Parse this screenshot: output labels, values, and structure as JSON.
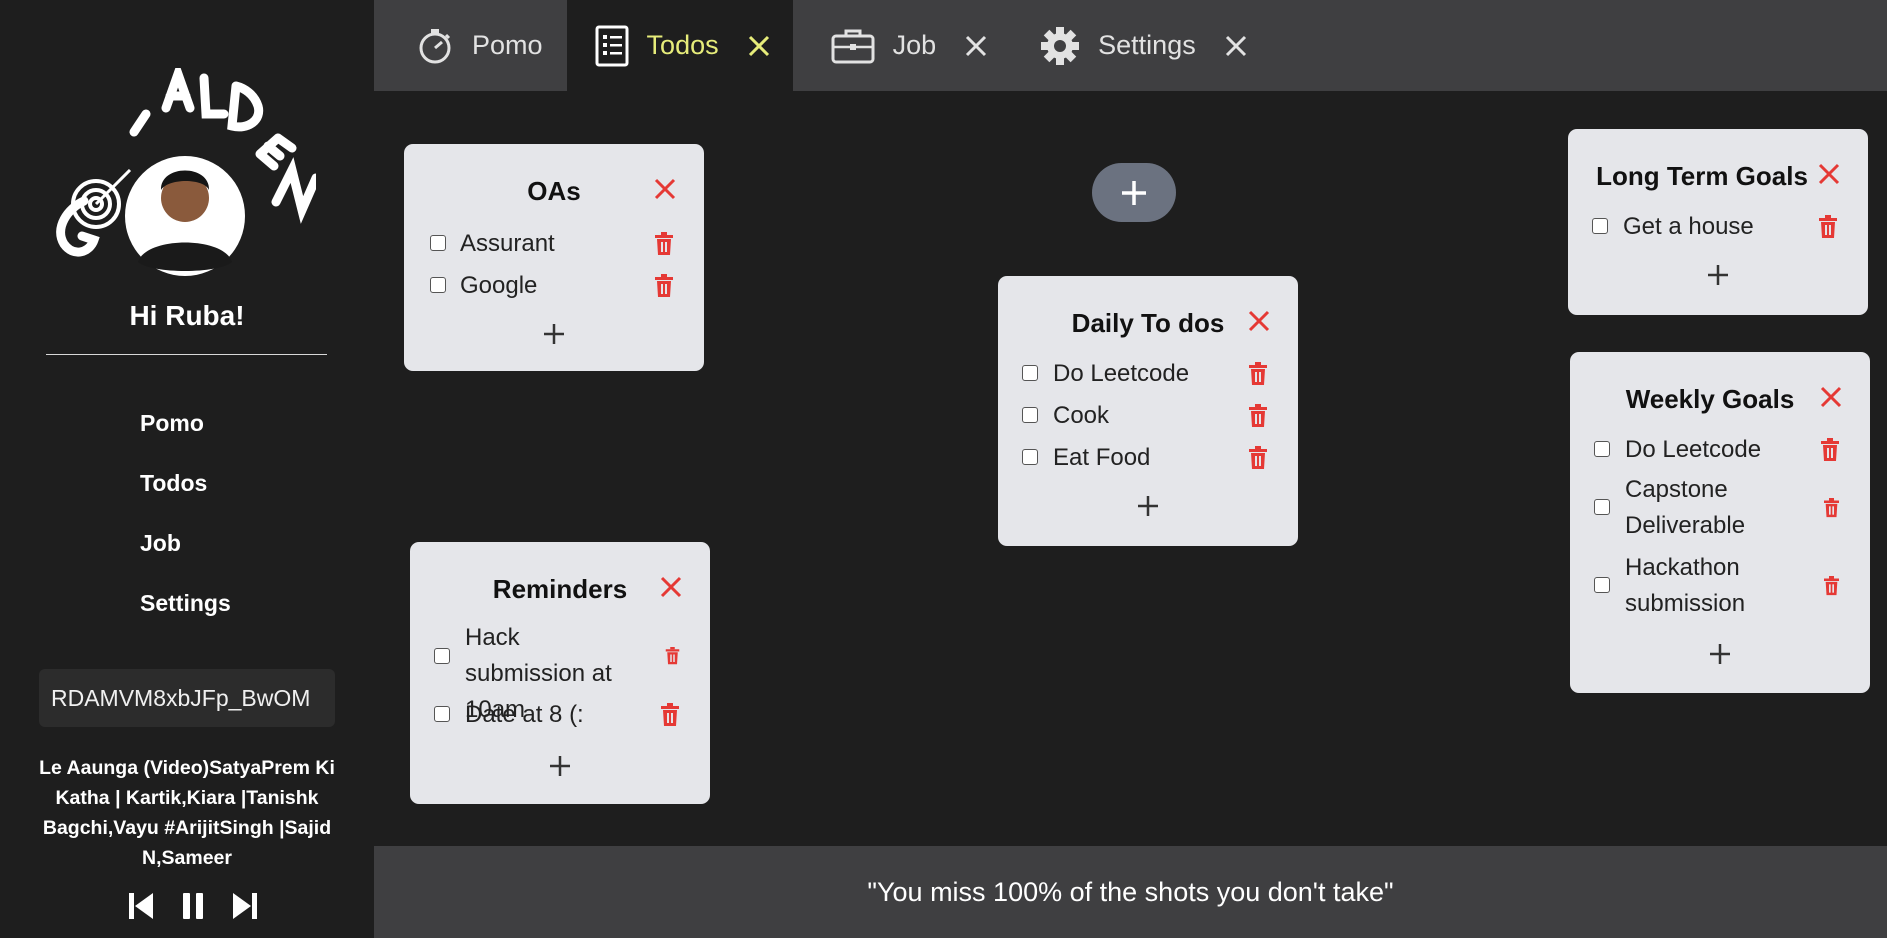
{
  "app": {
    "logo_text": "GOALDEN",
    "greeting": "Hi Ruba!"
  },
  "sidebar": {
    "nav": [
      "Pomo",
      "Todos",
      "Job",
      "Settings"
    ],
    "video_input_value": "RDAMVM8xbJFp_BwOM",
    "now_playing": "Le Aaunga (Video)SatyaPrem Ki Katha | Kartik,Kiara |Tanishk Bagchi,Vayu #ArijitSingh |Sajid N,Sameer"
  },
  "tabs": [
    {
      "label": "Pomo",
      "icon": "stopwatch-icon",
      "closable": false,
      "active": false
    },
    {
      "label": "Todos",
      "icon": "list-icon",
      "closable": true,
      "active": true
    },
    {
      "label": "Job",
      "icon": "briefcase-icon",
      "closable": true,
      "active": false
    },
    {
      "label": "Settings",
      "icon": "gear-icon",
      "closable": true,
      "active": false
    }
  ],
  "cards": {
    "oas": {
      "title": "OAs",
      "items": [
        "Assurant",
        "Google"
      ]
    },
    "reminders": {
      "title": "Reminders",
      "items": [
        "Hack submission at 10am",
        "Date at 8 (:"
      ]
    },
    "daily": {
      "title": "Daily To dos",
      "items": [
        "Do Leetcode",
        "Cook",
        "Eat Food"
      ]
    },
    "longterm": {
      "title": "Long Term Goals",
      "items": [
        "Get a house"
      ]
    },
    "weekly": {
      "title": "Weekly Goals",
      "items": [
        "Do Leetcode",
        "Capstone Deliverable",
        "Hackathon submission"
      ]
    }
  },
  "footer": {
    "quote": "\"You miss 100% of the shots you don't take\""
  },
  "colors": {
    "accent": "#e6ec7a",
    "danger": "#e53935",
    "card_bg": "#e5e6ea",
    "bar_bg": "#3f3f41"
  }
}
